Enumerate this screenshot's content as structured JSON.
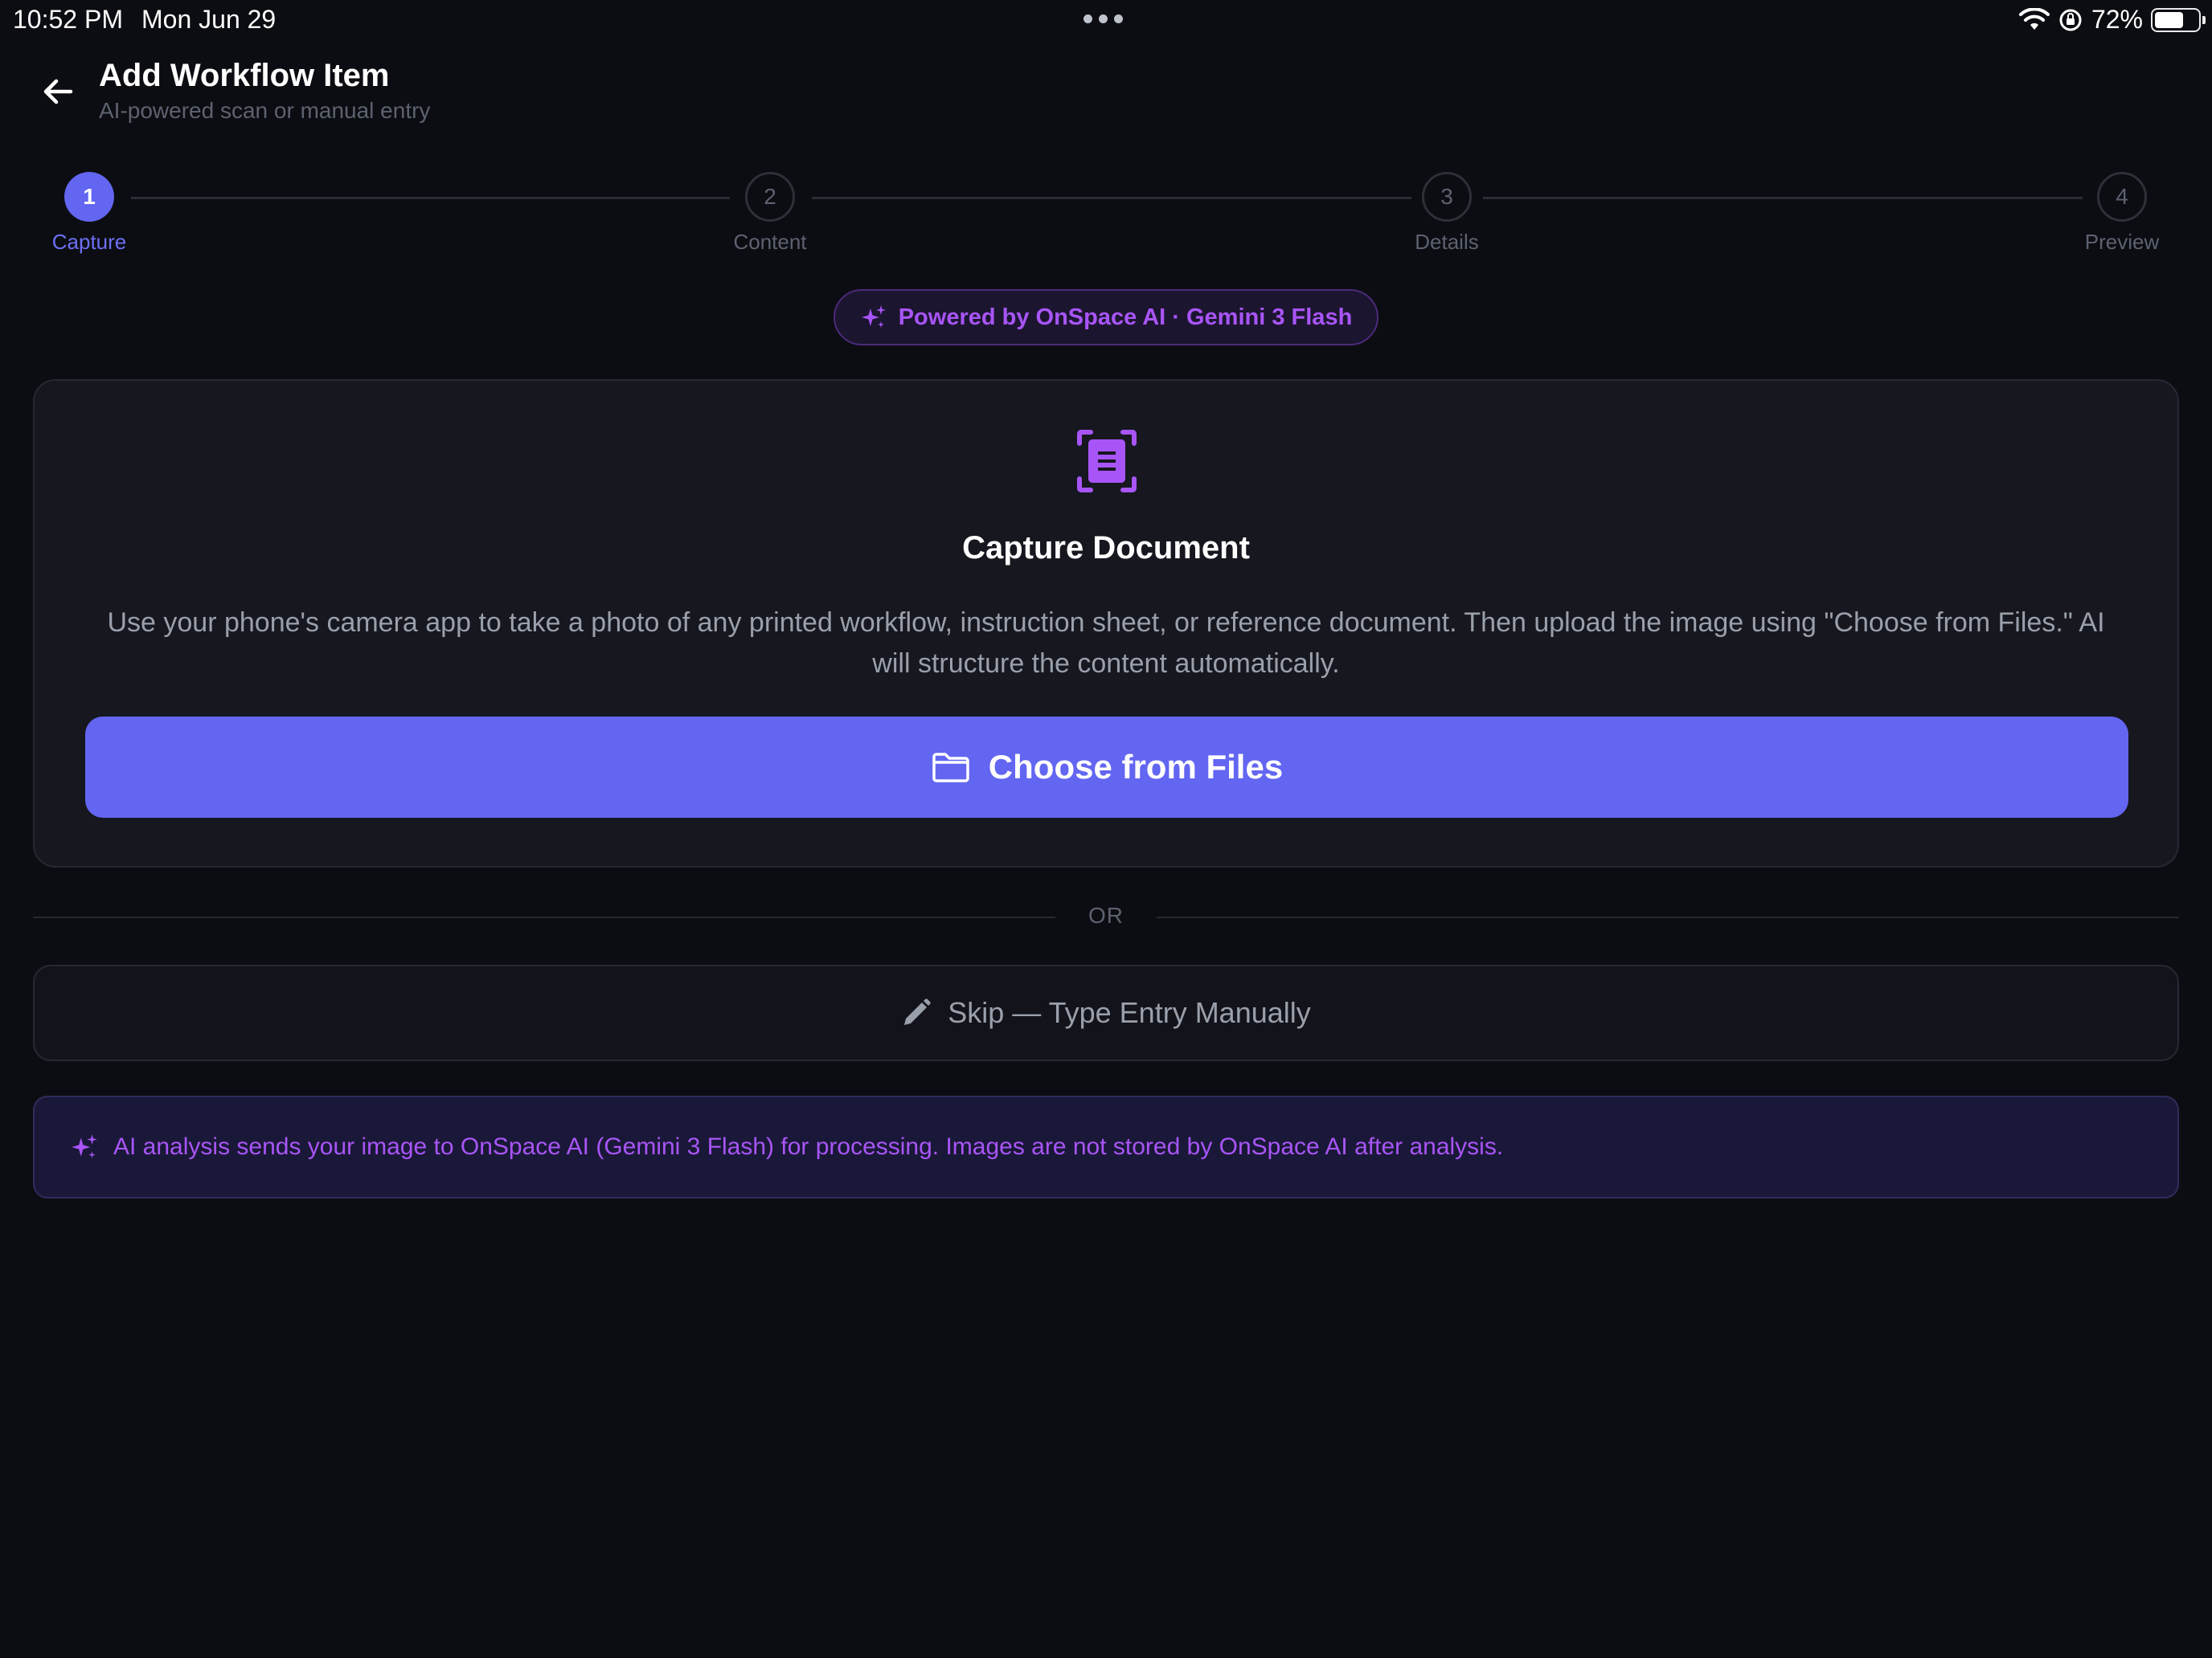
{
  "status_bar": {
    "time": "10:52 PM",
    "date": "Mon Jun 29",
    "battery": "72%"
  },
  "header": {
    "title": "Add Workflow Item",
    "subtitle": "AI-powered scan or manual entry"
  },
  "stepper": {
    "steps": [
      {
        "number": "1",
        "label": "Capture",
        "active": true
      },
      {
        "number": "2",
        "label": "Content",
        "active": false
      },
      {
        "number": "3",
        "label": "Details",
        "active": false
      },
      {
        "number": "4",
        "label": "Preview",
        "active": false
      }
    ]
  },
  "badge": {
    "text": "Powered by OnSpace AI · Gemini 3 Flash"
  },
  "capture": {
    "title": "Capture Document",
    "description": "Use your phone's camera app to take a photo of any printed workflow, instruction sheet, or reference document. Then upload the image using \"Choose from Files.\" AI will structure the content automatically.",
    "button_label": "Choose from Files"
  },
  "divider": {
    "text": "OR"
  },
  "skip": {
    "label": "Skip — Type Entry Manually"
  },
  "info": {
    "text": "AI analysis sends your image to OnSpace AI (Gemini 3 Flash) for processing. Images are not stored by OnSpace AI after analysis."
  },
  "colors": {
    "accent": "#6366f1",
    "ai_purple": "#a855f7",
    "background": "#0c0d12",
    "card": "#16171f"
  },
  "icons": {
    "back": "arrow-left-icon",
    "sparkle": "sparkles-icon",
    "scan": "document-scan-icon",
    "folder": "folder-icon",
    "pencil": "pencil-icon",
    "wifi": "wifi-icon",
    "orientation_lock": "orientation-lock-icon",
    "battery": "battery-icon"
  }
}
